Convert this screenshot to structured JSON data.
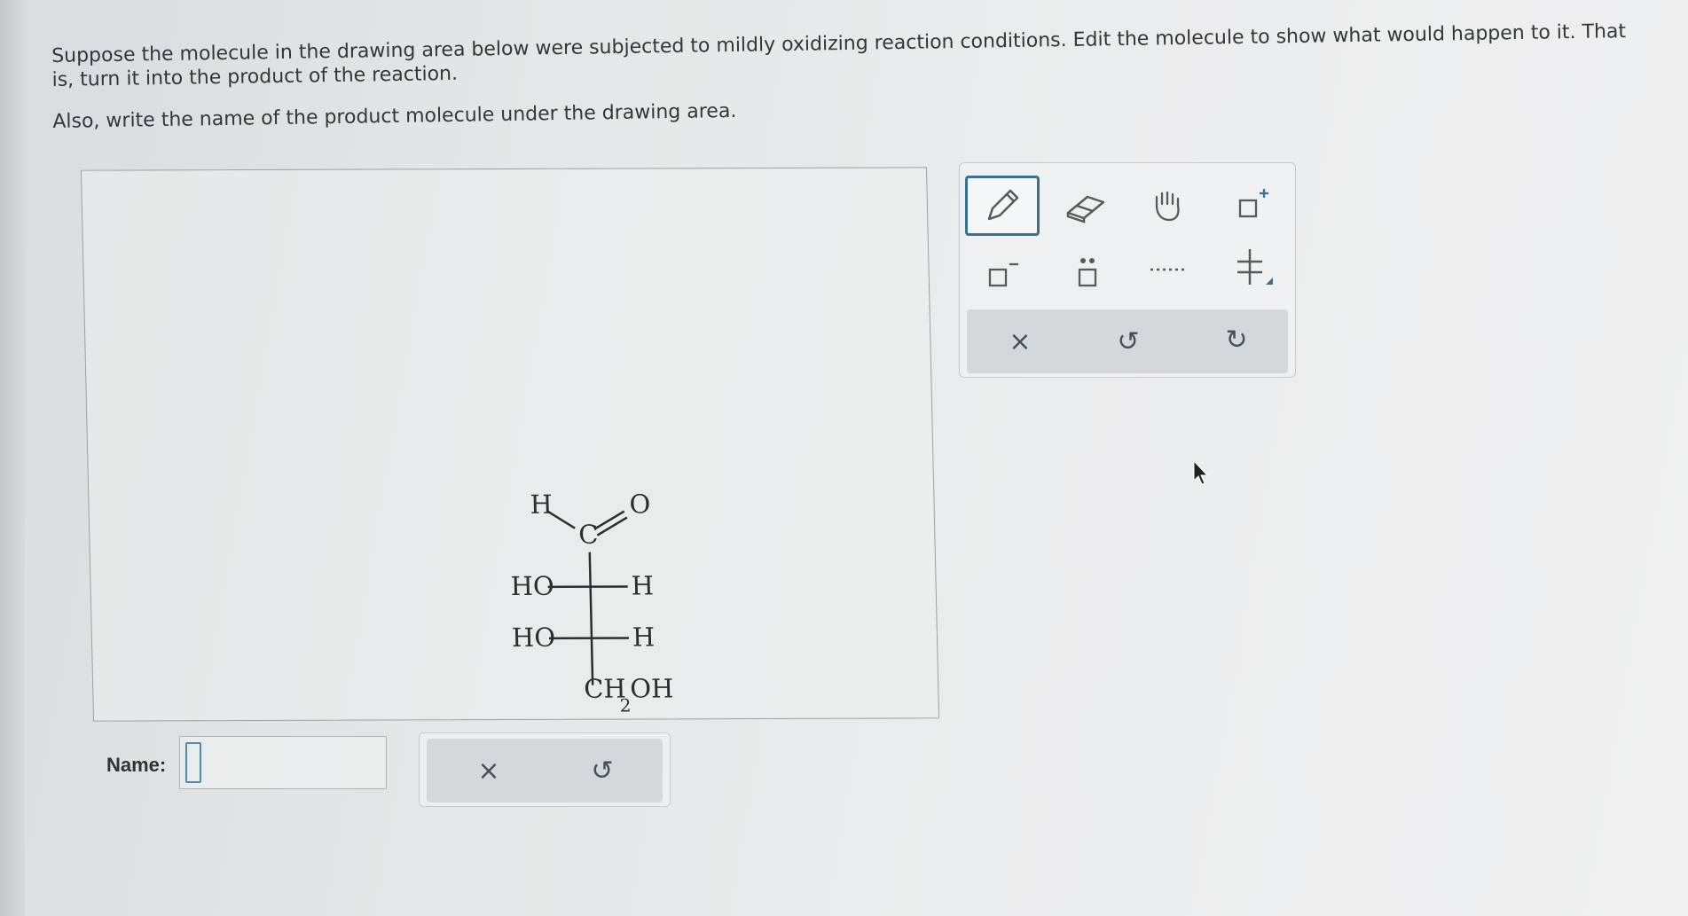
{
  "question": {
    "line1": "Suppose the molecule in the drawing area below were subjected to mildly oxidizing reaction conditions. Edit the molecule to show what would happen to it. That is, turn it into the product of the reaction.",
    "line2": "Also, write the name of the product molecule under the drawing area."
  },
  "molecule": {
    "top_h": "H",
    "carbonyl_c": "C",
    "carbonyl_o": "O",
    "row1_left": "HO",
    "row1_right": "H",
    "row2_left": "HO",
    "row2_right": "H",
    "bottom_main": "CH",
    "bottom_sub": "2",
    "bottom_tail": "OH"
  },
  "toolbar": {
    "tools": [
      "pencil-icon",
      "eraser-icon",
      "hand-icon",
      "positive-charge-icon",
      "negative-charge-icon",
      "lone-pair-icon",
      "dotted-bond-icon",
      "stereo-bond-icon"
    ],
    "clear_symbol": "×",
    "undo_symbol": "↺",
    "redo_symbol": "↻"
  },
  "name_field": {
    "label": "Name:",
    "value": ""
  },
  "name_actions": {
    "clear_symbol": "×",
    "undo_symbol": "↺"
  },
  "colors": {
    "accent": "#3a7193",
    "cursor_box": "#4f8ab0"
  }
}
